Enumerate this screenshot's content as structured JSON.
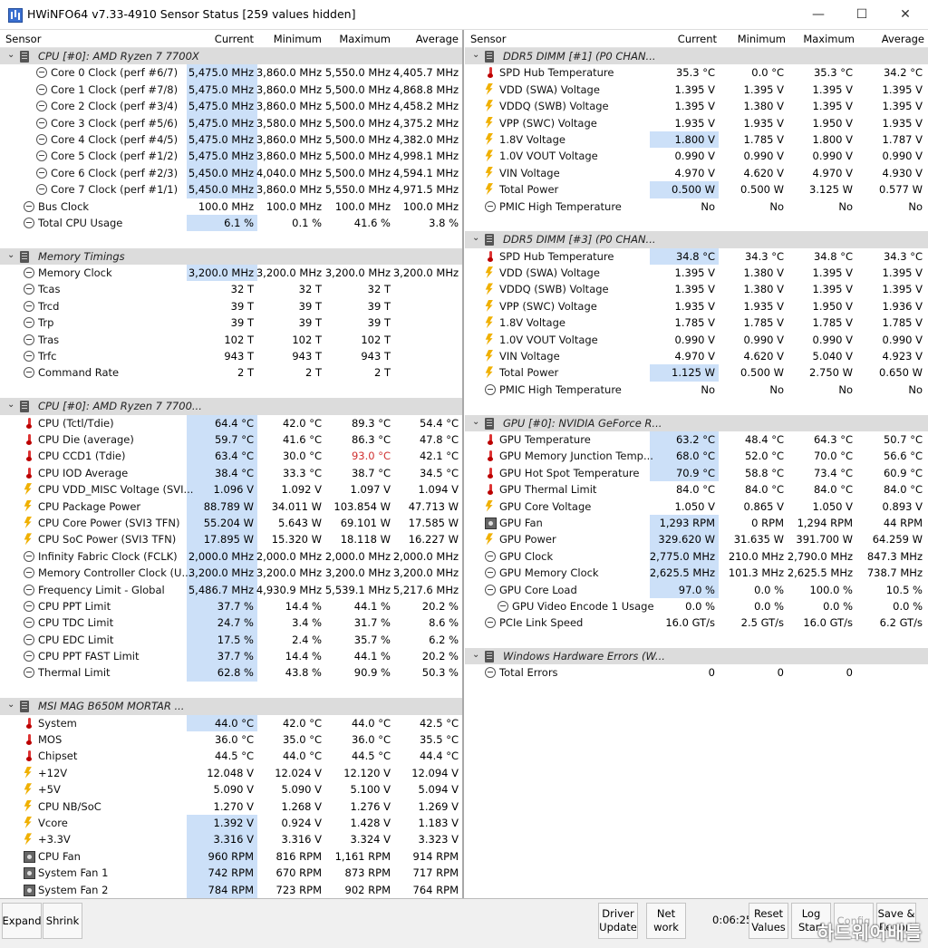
{
  "window": {
    "title": "HWiNFO64 v7.33-4910 Sensor Status [259 values hidden]",
    "minimize": "—",
    "maximize": "☐",
    "close": "✕"
  },
  "columns": [
    "Sensor",
    "Current",
    "Minimum",
    "Maximum",
    "Average"
  ],
  "left_panel": {
    "rows": [
      {
        "t": "g",
        "n": "CPU [#0]: AMD Ryzen 7 7700X"
      },
      {
        "i": "clock",
        "n": "Core 0 Clock (perf #6/7)",
        "c": "5,475.0 MHz",
        "mi": "3,860.0 MHz",
        "ma": "5,550.0 MHz",
        "av": "4,405.7 MHz",
        "ind": 2,
        "h": 1
      },
      {
        "i": "clock",
        "n": "Core 1 Clock (perf #7/8)",
        "c": "5,475.0 MHz",
        "mi": "3,860.0 MHz",
        "ma": "5,500.0 MHz",
        "av": "4,868.8 MHz",
        "ind": 2,
        "h": 1
      },
      {
        "i": "clock",
        "n": "Core 2 Clock (perf #3/4)",
        "c": "5,475.0 MHz",
        "mi": "3,860.0 MHz",
        "ma": "5,500.0 MHz",
        "av": "4,458.2 MHz",
        "ind": 2,
        "h": 1
      },
      {
        "i": "clock",
        "n": "Core 3 Clock (perf #5/6)",
        "c": "5,475.0 MHz",
        "mi": "3,580.0 MHz",
        "ma": "5,500.0 MHz",
        "av": "4,375.2 MHz",
        "ind": 2,
        "h": 1
      },
      {
        "i": "clock",
        "n": "Core 4 Clock (perf #4/5)",
        "c": "5,475.0 MHz",
        "mi": "3,860.0 MHz",
        "ma": "5,500.0 MHz",
        "av": "4,382.0 MHz",
        "ind": 2,
        "h": 1
      },
      {
        "i": "clock",
        "n": "Core 5 Clock (perf #1/2)",
        "c": "5,475.0 MHz",
        "mi": "3,860.0 MHz",
        "ma": "5,500.0 MHz",
        "av": "4,998.1 MHz",
        "ind": 2,
        "h": 1
      },
      {
        "i": "clock",
        "n": "Core 6 Clock (perf #2/3)",
        "c": "5,450.0 MHz",
        "mi": "4,040.0 MHz",
        "ma": "5,500.0 MHz",
        "av": "4,594.1 MHz",
        "ind": 2,
        "h": 1
      },
      {
        "i": "clock",
        "n": "Core 7 Clock (perf #1/1)",
        "c": "5,450.0 MHz",
        "mi": "3,860.0 MHz",
        "ma": "5,550.0 MHz",
        "av": "4,971.5 MHz",
        "ind": 2,
        "h": 1
      },
      {
        "i": "clock",
        "n": "Bus Clock",
        "c": "100.0 MHz",
        "mi": "100.0 MHz",
        "ma": "100.0 MHz",
        "av": "100.0 MHz"
      },
      {
        "i": "clock",
        "n": "Total CPU Usage",
        "c": "6.1 %",
        "mi": "0.1 %",
        "ma": "41.6 %",
        "av": "3.8 %",
        "h": 1
      },
      {
        "t": "b"
      },
      {
        "t": "g",
        "n": "Memory Timings"
      },
      {
        "i": "clock",
        "n": "Memory Clock",
        "c": "3,200.0 MHz",
        "mi": "3,200.0 MHz",
        "ma": "3,200.0 MHz",
        "av": "3,200.0 MHz",
        "h": 1
      },
      {
        "i": "clock",
        "n": "Tcas",
        "c": "32 T",
        "mi": "32 T",
        "ma": "32 T",
        "av": ""
      },
      {
        "i": "clock",
        "n": "Trcd",
        "c": "39 T",
        "mi": "39 T",
        "ma": "39 T",
        "av": ""
      },
      {
        "i": "clock",
        "n": "Trp",
        "c": "39 T",
        "mi": "39 T",
        "ma": "39 T",
        "av": ""
      },
      {
        "i": "clock",
        "n": "Tras",
        "c": "102 T",
        "mi": "102 T",
        "ma": "102 T",
        "av": ""
      },
      {
        "i": "clock",
        "n": "Trfc",
        "c": "943 T",
        "mi": "943 T",
        "ma": "943 T",
        "av": ""
      },
      {
        "i": "clock",
        "n": "Command Rate",
        "c": "2 T",
        "mi": "2 T",
        "ma": "2 T",
        "av": ""
      },
      {
        "t": "b"
      },
      {
        "t": "g",
        "n": "CPU [#0]: AMD Ryzen 7 7700..."
      },
      {
        "i": "temp",
        "n": "CPU (Tctl/Tdie)",
        "c": "64.4 °C",
        "mi": "42.0 °C",
        "ma": "89.3 °C",
        "av": "54.4 °C",
        "h": 1
      },
      {
        "i": "temp",
        "n": "CPU Die (average)",
        "c": "59.7 °C",
        "mi": "41.6 °C",
        "ma": "86.3 °C",
        "av": "47.8 °C",
        "h": 1
      },
      {
        "i": "temp",
        "n": "CPU CCD1 (Tdie)",
        "c": "63.4 °C",
        "mi": "30.0 °C",
        "ma": "93.0 °C",
        "av": "42.1 °C",
        "h": 1,
        "red": 1
      },
      {
        "i": "temp",
        "n": "CPU IOD Average",
        "c": "38.4 °C",
        "mi": "33.3 °C",
        "ma": "38.7 °C",
        "av": "34.5 °C",
        "h": 1
      },
      {
        "i": "volt",
        "n": "CPU VDD_MISC Voltage (SVI...",
        "c": "1.096 V",
        "mi": "1.092 V",
        "ma": "1.097 V",
        "av": "1.094 V",
        "h": 1
      },
      {
        "i": "volt",
        "n": "CPU Package Power",
        "c": "88.789 W",
        "mi": "34.011 W",
        "ma": "103.854 W",
        "av": "47.713 W",
        "h": 1
      },
      {
        "i": "volt",
        "n": "CPU Core Power (SVI3 TFN)",
        "c": "55.204 W",
        "mi": "5.643 W",
        "ma": "69.101 W",
        "av": "17.585 W",
        "h": 1
      },
      {
        "i": "volt",
        "n": "CPU SoC Power (SVI3 TFN)",
        "c": "17.895 W",
        "mi": "15.320 W",
        "ma": "18.118 W",
        "av": "16.227 W",
        "h": 1
      },
      {
        "i": "clock",
        "n": "Infinity Fabric Clock (FCLK)",
        "c": "2,000.0 MHz",
        "mi": "2,000.0 MHz",
        "ma": "2,000.0 MHz",
        "av": "2,000.0 MHz",
        "h": 1
      },
      {
        "i": "clock",
        "n": "Memory Controller Clock (U...",
        "c": "3,200.0 MHz",
        "mi": "3,200.0 MHz",
        "ma": "3,200.0 MHz",
        "av": "3,200.0 MHz",
        "h": 1
      },
      {
        "i": "clock",
        "n": "Frequency Limit - Global",
        "c": "5,486.7 MHz",
        "mi": "4,930.9 MHz",
        "ma": "5,539.1 MHz",
        "av": "5,217.6 MHz",
        "h": 1
      },
      {
        "i": "clock",
        "n": "CPU PPT Limit",
        "c": "37.7 %",
        "mi": "14.4 %",
        "ma": "44.1 %",
        "av": "20.2 %",
        "h": 1
      },
      {
        "i": "clock",
        "n": "CPU TDC Limit",
        "c": "24.7 %",
        "mi": "3.4 %",
        "ma": "31.7 %",
        "av": "8.6 %",
        "h": 1
      },
      {
        "i": "clock",
        "n": "CPU EDC Limit",
        "c": "17.5 %",
        "mi": "2.4 %",
        "ma": "35.7 %",
        "av": "6.2 %",
        "h": 1
      },
      {
        "i": "clock",
        "n": "CPU PPT FAST Limit",
        "c": "37.7 %",
        "mi": "14.4 %",
        "ma": "44.1 %",
        "av": "20.2 %",
        "h": 1
      },
      {
        "i": "clock",
        "n": "Thermal Limit",
        "c": "62.8 %",
        "mi": "43.8 %",
        "ma": "90.9 %",
        "av": "50.3 %",
        "h": 1
      },
      {
        "t": "b"
      },
      {
        "t": "g",
        "n": "MSI MAG B650M MORTAR ..."
      },
      {
        "i": "temp",
        "n": "System",
        "c": "44.0 °C",
        "mi": "42.0 °C",
        "ma": "44.0 °C",
        "av": "42.5 °C",
        "h": 1
      },
      {
        "i": "temp",
        "n": "MOS",
        "c": "36.0 °C",
        "mi": "35.0 °C",
        "ma": "36.0 °C",
        "av": "35.5 °C"
      },
      {
        "i": "temp",
        "n": "Chipset",
        "c": "44.5 °C",
        "mi": "44.0 °C",
        "ma": "44.5 °C",
        "av": "44.4 °C"
      },
      {
        "i": "volt",
        "n": "+12V",
        "c": "12.048 V",
        "mi": "12.024 V",
        "ma": "12.120 V",
        "av": "12.094 V"
      },
      {
        "i": "volt",
        "n": "+5V",
        "c": "5.090 V",
        "mi": "5.090 V",
        "ma": "5.100 V",
        "av": "5.094 V"
      },
      {
        "i": "volt",
        "n": "CPU NB/SoC",
        "c": "1.270 V",
        "mi": "1.268 V",
        "ma": "1.276 V",
        "av": "1.269 V"
      },
      {
        "i": "volt",
        "n": "Vcore",
        "c": "1.392 V",
        "mi": "0.924 V",
        "ma": "1.428 V",
        "av": "1.183 V",
        "h": 1
      },
      {
        "i": "volt",
        "n": "+3.3V",
        "c": "3.316 V",
        "mi": "3.316 V",
        "ma": "3.324 V",
        "av": "3.323 V",
        "h": 1
      },
      {
        "i": "fan",
        "n": "CPU Fan",
        "c": "960 RPM",
        "mi": "816 RPM",
        "ma": "1,161 RPM",
        "av": "914 RPM",
        "h": 1
      },
      {
        "i": "fan",
        "n": "System Fan 1",
        "c": "742 RPM",
        "mi": "670 RPM",
        "ma": "873 RPM",
        "av": "717 RPM",
        "h": 1
      },
      {
        "i": "fan",
        "n": "System Fan 2",
        "c": "784 RPM",
        "mi": "723 RPM",
        "ma": "902 RPM",
        "av": "764 RPM",
        "h": 1
      }
    ]
  },
  "right_panel": {
    "rows": [
      {
        "t": "g",
        "n": "DDR5 DIMM [#1] (P0 CHAN..."
      },
      {
        "i": "temp",
        "n": "SPD Hub Temperature",
        "c": "35.3 °C",
        "mi": "0.0 °C",
        "ma": "35.3 °C",
        "av": "34.2 °C"
      },
      {
        "i": "volt",
        "n": "VDD (SWA) Voltage",
        "c": "1.395 V",
        "mi": "1.395 V",
        "ma": "1.395 V",
        "av": "1.395 V"
      },
      {
        "i": "volt",
        "n": "VDDQ (SWB) Voltage",
        "c": "1.395 V",
        "mi": "1.380 V",
        "ma": "1.395 V",
        "av": "1.395 V"
      },
      {
        "i": "volt",
        "n": "VPP (SWC) Voltage",
        "c": "1.935 V",
        "mi": "1.935 V",
        "ma": "1.950 V",
        "av": "1.935 V"
      },
      {
        "i": "volt",
        "n": "1.8V Voltage",
        "c": "1.800 V",
        "mi": "1.785 V",
        "ma": "1.800 V",
        "av": "1.787 V",
        "h": 1
      },
      {
        "i": "volt",
        "n": "1.0V VOUT Voltage",
        "c": "0.990 V",
        "mi": "0.990 V",
        "ma": "0.990 V",
        "av": "0.990 V"
      },
      {
        "i": "volt",
        "n": "VIN Voltage",
        "c": "4.970 V",
        "mi": "4.620 V",
        "ma": "4.970 V",
        "av": "4.930 V"
      },
      {
        "i": "volt",
        "n": "Total Power",
        "c": "0.500 W",
        "mi": "0.500 W",
        "ma": "3.125 W",
        "av": "0.577 W",
        "h": 1
      },
      {
        "i": "clock",
        "n": "PMIC High Temperature",
        "c": "No",
        "mi": "No",
        "ma": "No",
        "av": "No"
      },
      {
        "t": "b"
      },
      {
        "t": "g",
        "n": "DDR5 DIMM [#3] (P0 CHAN..."
      },
      {
        "i": "temp",
        "n": "SPD Hub Temperature",
        "c": "34.8 °C",
        "mi": "34.3 °C",
        "ma": "34.8 °C",
        "av": "34.3 °C",
        "h": 1
      },
      {
        "i": "volt",
        "n": "VDD (SWA) Voltage",
        "c": "1.395 V",
        "mi": "1.380 V",
        "ma": "1.395 V",
        "av": "1.395 V"
      },
      {
        "i": "volt",
        "n": "VDDQ (SWB) Voltage",
        "c": "1.395 V",
        "mi": "1.380 V",
        "ma": "1.395 V",
        "av": "1.395 V"
      },
      {
        "i": "volt",
        "n": "VPP (SWC) Voltage",
        "c": "1.935 V",
        "mi": "1.935 V",
        "ma": "1.950 V",
        "av": "1.936 V"
      },
      {
        "i": "volt",
        "n": "1.8V Voltage",
        "c": "1.785 V",
        "mi": "1.785 V",
        "ma": "1.785 V",
        "av": "1.785 V"
      },
      {
        "i": "volt",
        "n": "1.0V VOUT Voltage",
        "c": "0.990 V",
        "mi": "0.990 V",
        "ma": "0.990 V",
        "av": "0.990 V"
      },
      {
        "i": "volt",
        "n": "VIN Voltage",
        "c": "4.970 V",
        "mi": "4.620 V",
        "ma": "5.040 V",
        "av": "4.923 V"
      },
      {
        "i": "volt",
        "n": "Total Power",
        "c": "1.125 W",
        "mi": "0.500 W",
        "ma": "2.750 W",
        "av": "0.650 W",
        "h": 1
      },
      {
        "i": "clock",
        "n": "PMIC High Temperature",
        "c": "No",
        "mi": "No",
        "ma": "No",
        "av": "No"
      },
      {
        "t": "b"
      },
      {
        "t": "g",
        "n": "GPU [#0]: NVIDIA GeForce R..."
      },
      {
        "i": "temp",
        "n": "GPU Temperature",
        "c": "63.2 °C",
        "mi": "48.4 °C",
        "ma": "64.3 °C",
        "av": "50.7 °C",
        "h": 1
      },
      {
        "i": "temp",
        "n": "GPU Memory Junction Temp...",
        "c": "68.0 °C",
        "mi": "52.0 °C",
        "ma": "70.0 °C",
        "av": "56.6 °C",
        "h": 1
      },
      {
        "i": "temp",
        "n": "GPU Hot Spot Temperature",
        "c": "70.9 °C",
        "mi": "58.8 °C",
        "ma": "73.4 °C",
        "av": "60.9 °C",
        "h": 1
      },
      {
        "i": "temp",
        "n": "GPU Thermal Limit",
        "c": "84.0 °C",
        "mi": "84.0 °C",
        "ma": "84.0 °C",
        "av": "84.0 °C"
      },
      {
        "i": "volt",
        "n": "GPU Core Voltage",
        "c": "1.050 V",
        "mi": "0.865 V",
        "ma": "1.050 V",
        "av": "0.893 V"
      },
      {
        "i": "fan",
        "n": "GPU Fan",
        "c": "1,293 RPM",
        "mi": "0 RPM",
        "ma": "1,294 RPM",
        "av": "44 RPM",
        "h": 1
      },
      {
        "i": "volt",
        "n": "GPU Power",
        "c": "329.620 W",
        "mi": "31.635 W",
        "ma": "391.700 W",
        "av": "64.259 W",
        "h": 1
      },
      {
        "i": "clock",
        "n": "GPU Clock",
        "c": "2,775.0 MHz",
        "mi": "210.0 MHz",
        "ma": "2,790.0 MHz",
        "av": "847.3 MHz",
        "h": 1
      },
      {
        "i": "clock",
        "n": "GPU Memory Clock",
        "c": "2,625.5 MHz",
        "mi": "101.3 MHz",
        "ma": "2,625.5 MHz",
        "av": "738.7 MHz",
        "h": 1
      },
      {
        "i": "clock",
        "n": "GPU Core Load",
        "c": "97.0 %",
        "mi": "0.0 %",
        "ma": "100.0 %",
        "av": "10.5 %",
        "h": 1
      },
      {
        "i": "clock",
        "n": "GPU Video Encode 1 Usage",
        "c": "0.0 %",
        "mi": "0.0 %",
        "ma": "0.0 %",
        "av": "0.0 %",
        "ind": 2
      },
      {
        "i": "clock",
        "n": "PCIe Link Speed",
        "c": "16.0 GT/s",
        "mi": "2.5 GT/s",
        "ma": "16.0 GT/s",
        "av": "6.2 GT/s"
      },
      {
        "t": "b"
      },
      {
        "t": "g",
        "n": "Windows Hardware Errors (W..."
      },
      {
        "i": "clock",
        "n": "Total Errors",
        "c": "0",
        "mi": "0",
        "ma": "0",
        "av": ""
      }
    ]
  },
  "footer": {
    "expand": "Expand",
    "shrink": "Shrink",
    "driver_update": "Driver Update",
    "net_work": "Net work",
    "timer": "0:06:25",
    "reset_values": "Reset Values",
    "log_start": "Log Start",
    "config": "Config",
    "save_report": "Save & Report",
    "watermark": "하드웨어배틀"
  }
}
